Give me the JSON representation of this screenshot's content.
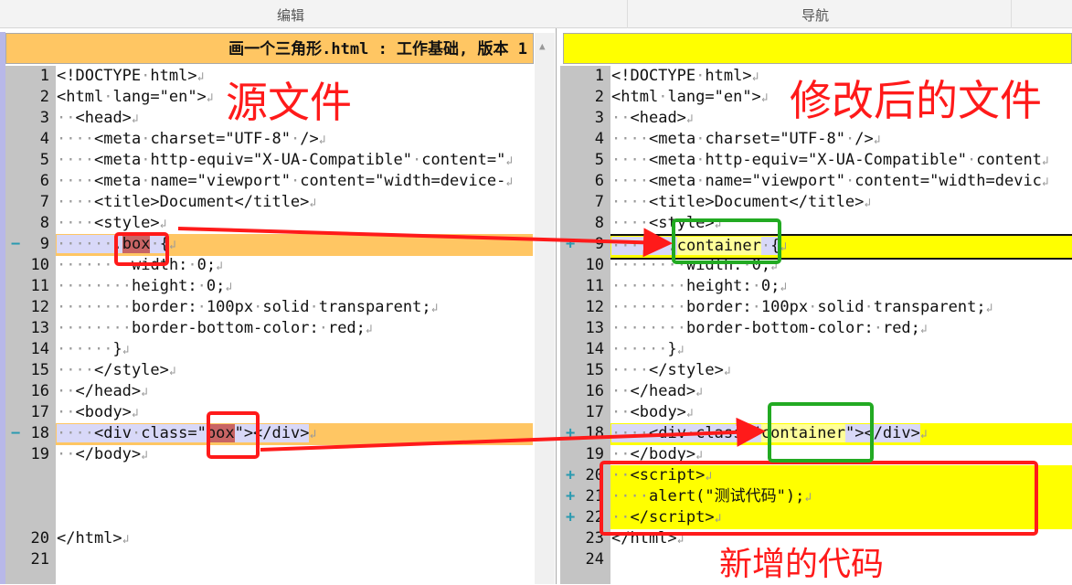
{
  "header": {
    "left_label": "编辑",
    "right_label": "导航"
  },
  "colors": {
    "modified_left": "#ffc663",
    "modified_right": "#ffff00",
    "annotation_red": "#ff1a1a",
    "annotation_green": "#22aa22"
  },
  "left": {
    "title": "画一个三角形.html : 工作基础, 版本 1",
    "lines": [
      {
        "num": "1",
        "segs": [
          {
            "t": "<!DOCTYPE·html>"
          }
        ]
      },
      {
        "num": "2",
        "segs": [
          {
            "t": "<html·lang=\"en\">"
          }
        ]
      },
      {
        "num": "3",
        "segs": [
          {
            "t": "··<head>"
          }
        ]
      },
      {
        "num": "4",
        "segs": [
          {
            "t": "····<meta·charset=\"UTF-8\"·/>"
          }
        ]
      },
      {
        "num": "5",
        "segs": [
          {
            "t": "····<meta·http-equiv=\"X-UA-Compatible\"·content=\""
          }
        ]
      },
      {
        "num": "6",
        "segs": [
          {
            "t": "····<meta·name=\"viewport\"·content=\"width=device-"
          }
        ]
      },
      {
        "num": "7",
        "segs": [
          {
            "t": "····<title>Document</title>"
          }
        ]
      },
      {
        "num": "8",
        "segs": [
          {
            "t": "····<style>"
          }
        ]
      },
      {
        "num": "9",
        "marker": "−",
        "type": "mod",
        "segs": [
          {
            "t": "······."
          },
          {
            "t": "box",
            "c": "tok-del"
          },
          {
            "t": "·{"
          }
        ]
      },
      {
        "num": "10",
        "segs": [
          {
            "t": "········width:·0;"
          }
        ]
      },
      {
        "num": "11",
        "segs": [
          {
            "t": "········height:·0;"
          }
        ]
      },
      {
        "num": "12",
        "segs": [
          {
            "t": "········border:·100px·solid·transparent;"
          }
        ]
      },
      {
        "num": "13",
        "segs": [
          {
            "t": "········border-bottom-color:·red;"
          }
        ]
      },
      {
        "num": "14",
        "segs": [
          {
            "t": "······}"
          }
        ]
      },
      {
        "num": "15",
        "segs": [
          {
            "t": "····</style>"
          }
        ]
      },
      {
        "num": "16",
        "segs": [
          {
            "t": "··</head>"
          }
        ]
      },
      {
        "num": "17",
        "segs": [
          {
            "t": "··<body>"
          }
        ]
      },
      {
        "num": "18",
        "marker": "−",
        "type": "mod",
        "segs": [
          {
            "t": "····<div·class=\""
          },
          {
            "t": "box",
            "c": "tok-del"
          },
          {
            "t": "\"></div>"
          }
        ]
      },
      {
        "num": "19",
        "segs": [
          {
            "t": "··</body>"
          }
        ]
      },
      {
        "num": "",
        "type": "gap",
        "segs": []
      },
      {
        "num": "20",
        "segs": [
          {
            "t": "</html>"
          }
        ]
      },
      {
        "num": "21",
        "segs": [],
        "noret": true
      }
    ]
  },
  "right": {
    "title": "",
    "lines": [
      {
        "num": "1",
        "segs": [
          {
            "t": "<!DOCTYPE·html>"
          }
        ]
      },
      {
        "num": "2",
        "segs": [
          {
            "t": "<html·lang=\"en\">"
          }
        ]
      },
      {
        "num": "3",
        "segs": [
          {
            "t": "··<head>"
          }
        ]
      },
      {
        "num": "4",
        "segs": [
          {
            "t": "····<meta·charset=\"UTF-8\"·/>"
          }
        ]
      },
      {
        "num": "5",
        "segs": [
          {
            "t": "····<meta·http-equiv=\"X-UA-Compatible\"·content"
          }
        ]
      },
      {
        "num": "6",
        "segs": [
          {
            "t": "····<meta·name=\"viewport\"·content=\"width=devic"
          }
        ]
      },
      {
        "num": "7",
        "segs": [
          {
            "t": "····<title>Document</title>"
          }
        ]
      },
      {
        "num": "8",
        "segs": [
          {
            "t": "····<style>"
          }
        ]
      },
      {
        "num": "9",
        "marker": "+",
        "type": "mod",
        "border": true,
        "segs": [
          {
            "t": "······."
          },
          {
            "t": "container",
            "c": "tok-add"
          },
          {
            "t": "·{"
          }
        ]
      },
      {
        "num": "10",
        "segs": [
          {
            "t": "········width:·0;"
          }
        ]
      },
      {
        "num": "11",
        "segs": [
          {
            "t": "········height:·0;"
          }
        ]
      },
      {
        "num": "12",
        "segs": [
          {
            "t": "········border:·100px·solid·transparent;"
          }
        ]
      },
      {
        "num": "13",
        "segs": [
          {
            "t": "········border-bottom-color:·red;"
          }
        ]
      },
      {
        "num": "14",
        "segs": [
          {
            "t": "······}"
          }
        ]
      },
      {
        "num": "15",
        "segs": [
          {
            "t": "····</style>"
          }
        ]
      },
      {
        "num": "16",
        "segs": [
          {
            "t": "··</head>"
          }
        ]
      },
      {
        "num": "17",
        "segs": [
          {
            "t": "··<body>"
          }
        ]
      },
      {
        "num": "18",
        "marker": "+",
        "type": "mod",
        "segs": [
          {
            "t": "····<div·class=\""
          },
          {
            "t": "container",
            "c": "tok-add"
          },
          {
            "t": "\"></div>"
          }
        ]
      },
      {
        "num": "19",
        "segs": [
          {
            "t": "··</body>"
          }
        ]
      },
      {
        "num": "20",
        "marker": "+",
        "type": "add",
        "segs": [
          {
            "t": "··<script>"
          }
        ]
      },
      {
        "num": "21",
        "marker": "+",
        "type": "add",
        "segs": [
          {
            "t": "····alert(\"测试代码\");"
          }
        ]
      },
      {
        "num": "22",
        "marker": "+",
        "type": "add",
        "segs": [
          {
            "t": "··</script>"
          }
        ]
      },
      {
        "num": "23",
        "segs": [
          {
            "t": "</html>"
          }
        ]
      },
      {
        "num": "24",
        "segs": [],
        "noret": true
      }
    ]
  },
  "annotations": {
    "source_file": "源文件",
    "modified_file": "修改后的文件",
    "added_code": "新增的代码"
  }
}
